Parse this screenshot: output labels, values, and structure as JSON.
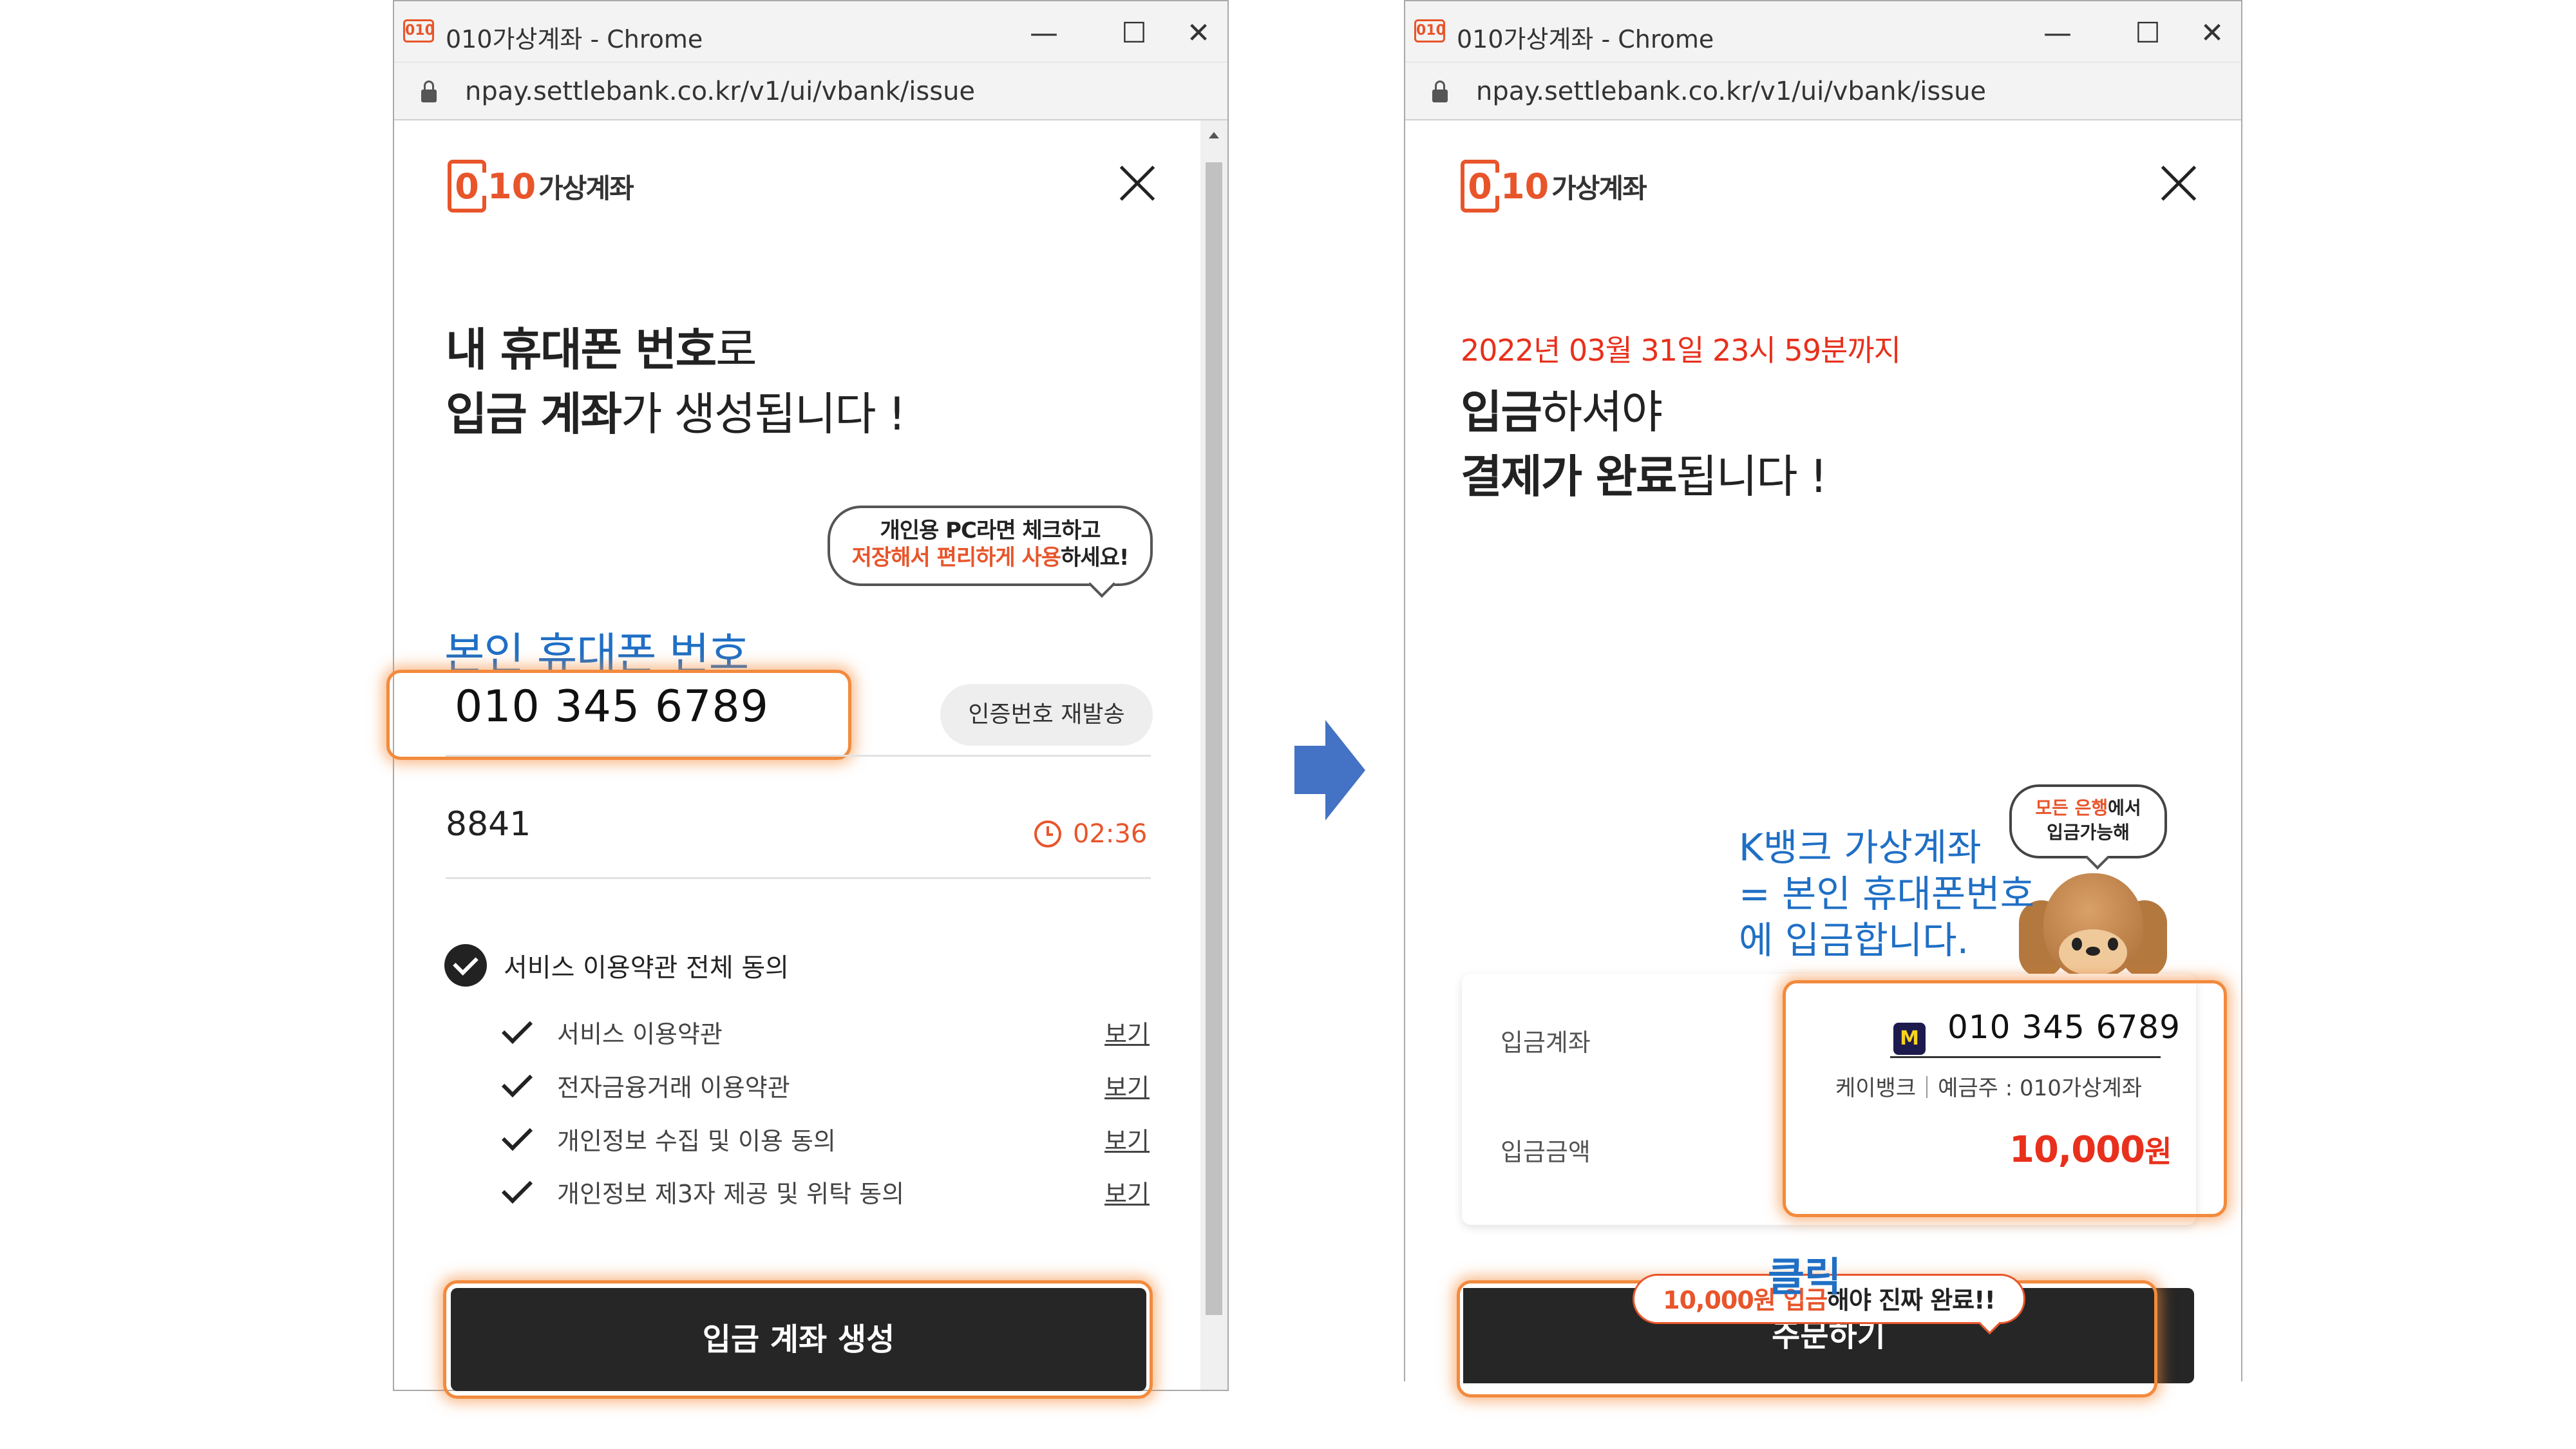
{
  "left_window": {
    "title": "010가상계좌 - Chrome",
    "url": "npay.settlebank.co.kr/v1/ui/vbank/issue",
    "logo_mark": "0",
    "logo_digits": "10",
    "logo_text": "가상계좌",
    "headline": {
      "line1_bold": "내 휴대폰 번호",
      "line1_rest": "로",
      "line2_bold": "입금 계좌",
      "line2_rest": "가 생성됩니다 !"
    },
    "bubble": {
      "line1": "개인용 PC라면 체크하고",
      "line2_orange": "저장해서 편리하게 사용",
      "line2_rest": "하세요!"
    },
    "phone_label": "본인 휴대폰 번호",
    "phone_value": "010 345 6789",
    "resend_label": "인증번호 재발송",
    "auth_code": "8841",
    "timer": "02:36",
    "agree_all": "서비스 이용약관 전체 동의",
    "terms": [
      {
        "label": "서비스 이용약관",
        "view": "보기"
      },
      {
        "label": "전자금융거래 이용약관",
        "view": "보기"
      },
      {
        "label": "개인정보 수집 및 이용 동의",
        "view": "보기"
      },
      {
        "label": "개인정보 제3자 제공 및 위탁 동의",
        "view": "보기"
      }
    ],
    "issue_button": "입금 계좌 생성"
  },
  "right_window": {
    "title": "010가상계좌 - Chrome",
    "url": "npay.settlebank.co.kr/v1/ui/vbank/issue",
    "logo_mark": "0",
    "logo_digits": "10",
    "logo_text": "가상계좌",
    "deadline": "2022년 03월 31일 23시 59분까지",
    "headline": {
      "line1_bold": "입금",
      "line1_rest": "하셔야",
      "line2_bold": "결제가 완료",
      "line2_rest": "됩니다 !"
    },
    "bubble": {
      "line1_orange": "모든 은행",
      "line1_rest": "에서",
      "line2": "입금가능해"
    },
    "annotation": [
      "K뱅크 가상계좌",
      "= 본인 휴대폰번호",
      "에 입금합니다."
    ],
    "deposit_account_label": "입금계좌",
    "bank_icon_letter": "M",
    "account_number": "010 345 6789",
    "bank_name": "케이뱅크",
    "holder": "예금주 : 010가상계좌",
    "deposit_amount_label": "입금금액",
    "amount": "10,000",
    "amount_unit": "원",
    "click_label": "클릭",
    "order_bubble": {
      "orange": "10,000원 입금",
      "rest": "해야 진짜 완료!!"
    },
    "order_button": "주문하기"
  },
  "colors": {
    "brand_orange": "#e8552b",
    "deadline_red": "#e8301c",
    "annotation_blue": "#1f6fc5",
    "arrow_blue": "#4472c4",
    "button_dark": "#262626"
  }
}
